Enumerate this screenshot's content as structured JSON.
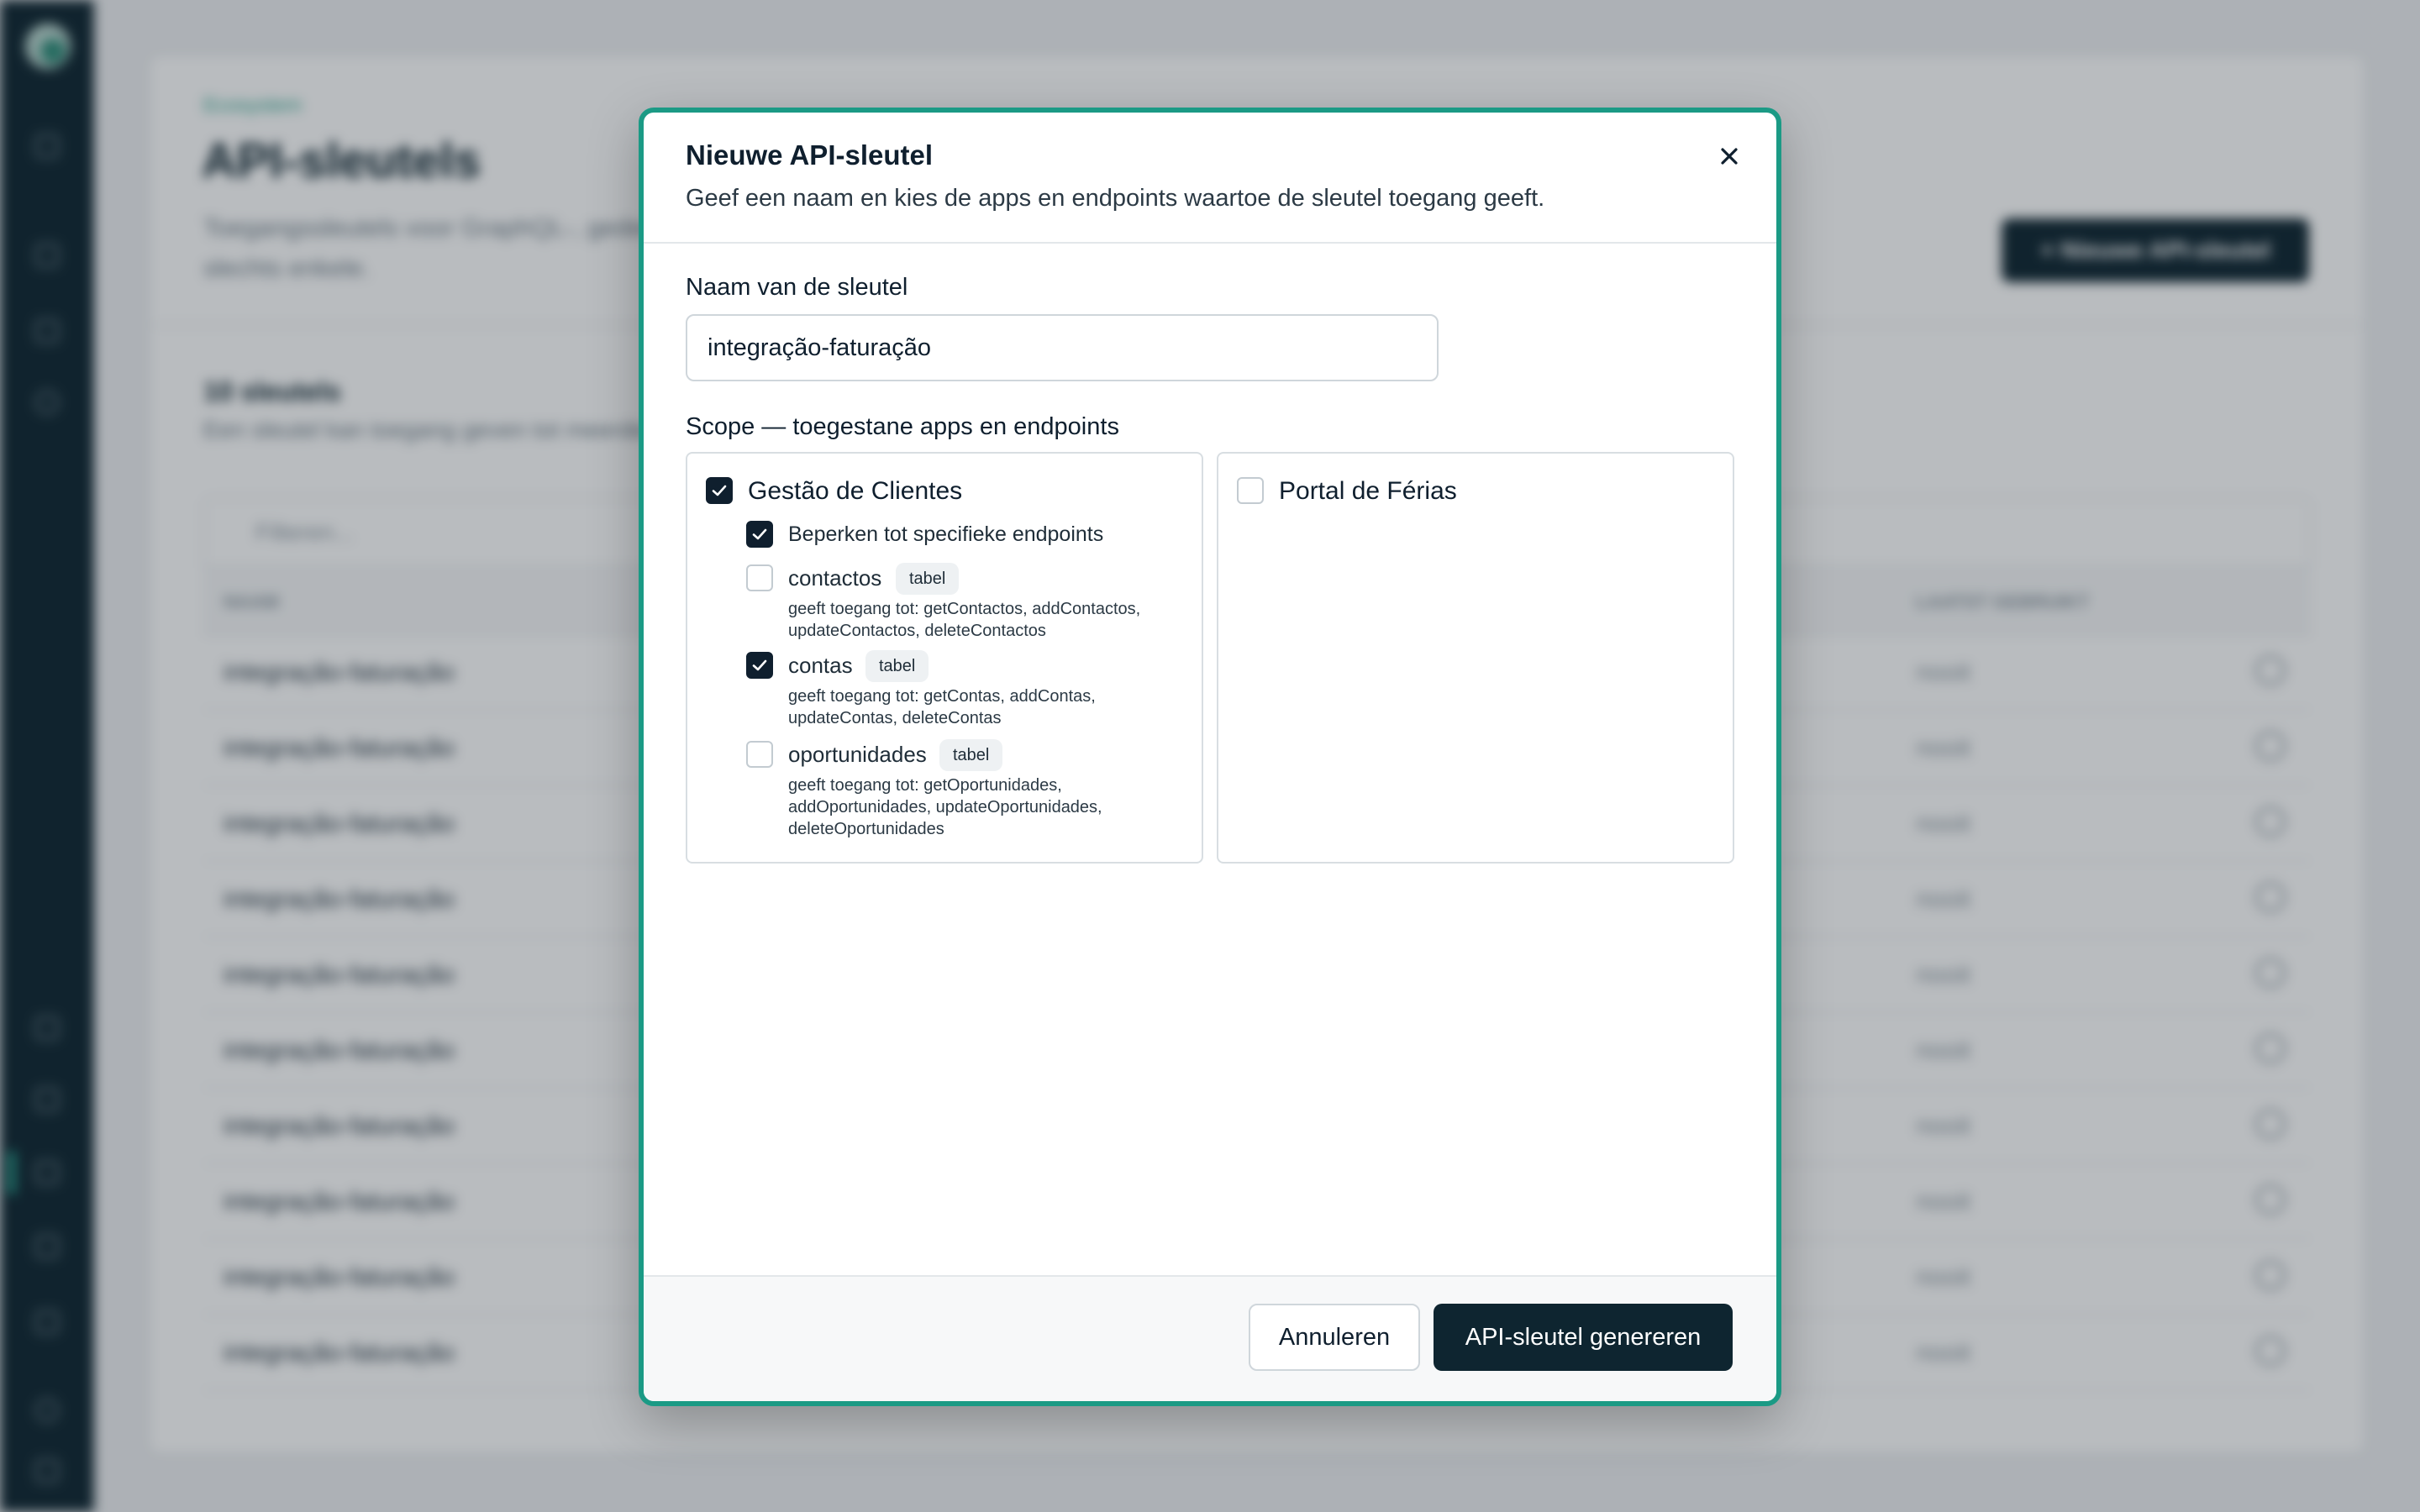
{
  "background": {
    "breadcrumb": "Ecosystem",
    "page_title": "API-sleutels",
    "page_description": "Toegangssleutels voor GraphQL-, gedeelde endpoints of slechts enkele.",
    "new_key_button": "+ Nieuwe API-sleutel",
    "count_title": "10 sleutels",
    "count_description": "Een sleutel kan toegang geven tot meerdere apps en endpoints.",
    "filter_placeholder": "Filteren...",
    "columns": {
      "name": "NAAM",
      "last_used": "LAATST GEBRUIKT"
    },
    "rows": [
      {
        "name": "integração-faturação",
        "last_used": "nooit"
      },
      {
        "name": "integração-faturação",
        "last_used": "nooit"
      },
      {
        "name": "integração-faturação",
        "last_used": "nooit"
      },
      {
        "name": "integração-faturação",
        "last_used": "nooit"
      },
      {
        "name": "integração-faturação",
        "last_used": "nooit"
      },
      {
        "name": "integração-faturação",
        "last_used": "nooit"
      },
      {
        "name": "integração-faturação",
        "last_used": "nooit"
      },
      {
        "name": "integração-faturação",
        "last_used": "nooit"
      },
      {
        "name": "integração-faturação",
        "last_used": "nooit"
      },
      {
        "name": "integração-faturação",
        "last_used": "nooit"
      }
    ]
  },
  "dialog": {
    "title": "Nieuwe API-sleutel",
    "subtitle": "Geef een naam en kies de apps en endpoints waartoe de sleutel toegang geeft.",
    "close_icon": "close-icon",
    "name_label": "Naam van de sleutel",
    "name_value": "integração-faturação",
    "scope_label": "Scope — toegestane apps en endpoints",
    "apps": [
      {
        "name": "Gestão de Clientes",
        "checked": true,
        "restrict_label": "Beperken tot specifieke endpoints",
        "restrict_checked": true,
        "endpoints": [
          {
            "name": "contactos",
            "tag": "tabel",
            "checked": false,
            "desc": "geeft toegang tot: getContactos, addContactos, updateContactos, deleteContactos"
          },
          {
            "name": "contas",
            "tag": "tabel",
            "checked": true,
            "desc": "geeft toegang tot: getContas, addContas, updateContas, deleteContas"
          },
          {
            "name": "oportunidades",
            "tag": "tabel",
            "checked": false,
            "desc": "geeft toegang tot: getOportunidades, addOportunidades, updateOportunidades, deleteOportunidades"
          }
        ]
      },
      {
        "name": "Portal de Férias",
        "checked": false
      }
    ],
    "cancel_label": "Annuleren",
    "generate_label": "API-sleutel genereren"
  },
  "colors": {
    "accent": "#1b9a85",
    "primary": "#0e2530",
    "sidebar": "#0e2530"
  }
}
